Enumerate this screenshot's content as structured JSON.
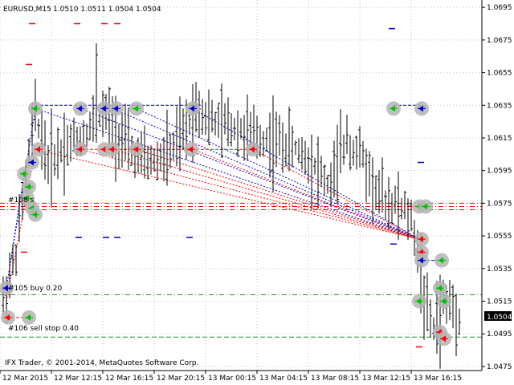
{
  "header": {
    "symbol_timeframe": "EURUSD,M15",
    "ohlc": "1.0510 1.0511 1.0504 1.0504"
  },
  "footer": {
    "copyright": "IFX Trader, © 2001-2014, MetaQuotes Software Corp."
  },
  "current_price": "1.0504",
  "colors": {
    "background": "#ffffff",
    "grid": "#c0c0c0",
    "bars": "#000000",
    "buy_order_line": "#228b22",
    "sell_order_line": "#228b22",
    "level_red": "#ff0000",
    "trade_buy": "#0000cd",
    "trade_sell": "#ff0000",
    "marker_ring": "#b4b4b4",
    "marker_green": "#00c000",
    "price_box": "#000000"
  },
  "order_labels": [
    {
      "id": "order-108",
      "text": "#108 s"
    },
    {
      "id": "order-105",
      "text": "#105 buy 0.20"
    },
    {
      "id": "order-106",
      "text": "#106 sell stop 0.40"
    }
  ],
  "chart_data": {
    "type": "candlestick-ohlc-bars",
    "symbol": "EURUSD",
    "timeframe": "M15",
    "y_axis_ticks": [
      "1.0695",
      "1.0675",
      "1.0655",
      "1.0635",
      "1.0615",
      "1.0595",
      "1.0575",
      "1.0555",
      "1.0535",
      "1.0515",
      "1.0495",
      "1.0475"
    ],
    "y_values": [
      1.0695,
      1.0675,
      1.0655,
      1.0635,
      1.0615,
      1.0595,
      1.0575,
      1.0555,
      1.0535,
      1.0515,
      1.0495,
      1.0475
    ],
    "x_axis_ticks": [
      "12 Mar 2015",
      "12 Mar 12:15",
      "12 Mar 16:15",
      "12 Mar 20:15",
      "13 Mar 00:15",
      "13 Mar 04:15",
      "13 Mar 08:15",
      "13 Mar 12:15",
      "13 Mar 16:15"
    ],
    "ylim": [
      1.04725,
      1.06995
    ],
    "grid": true,
    "last_close": 1.0504,
    "horizontal_levels": [
      {
        "label": "#108 s",
        "price": 1.0575,
        "style": "dash-dot",
        "color": "red"
      },
      {
        "label": "",
        "price": 1.0573,
        "style": "dash-dot",
        "color": "red"
      },
      {
        "label": "",
        "price": 1.0571,
        "style": "dash-dot",
        "color": "red"
      },
      {
        "label": "#105 buy 0.20",
        "price": 1.0519,
        "style": "dash-dot",
        "color": "green"
      },
      {
        "label": "#106 sell stop 0.40",
        "price": 1.0493,
        "style": "dash",
        "color": "green"
      }
    ]
  }
}
